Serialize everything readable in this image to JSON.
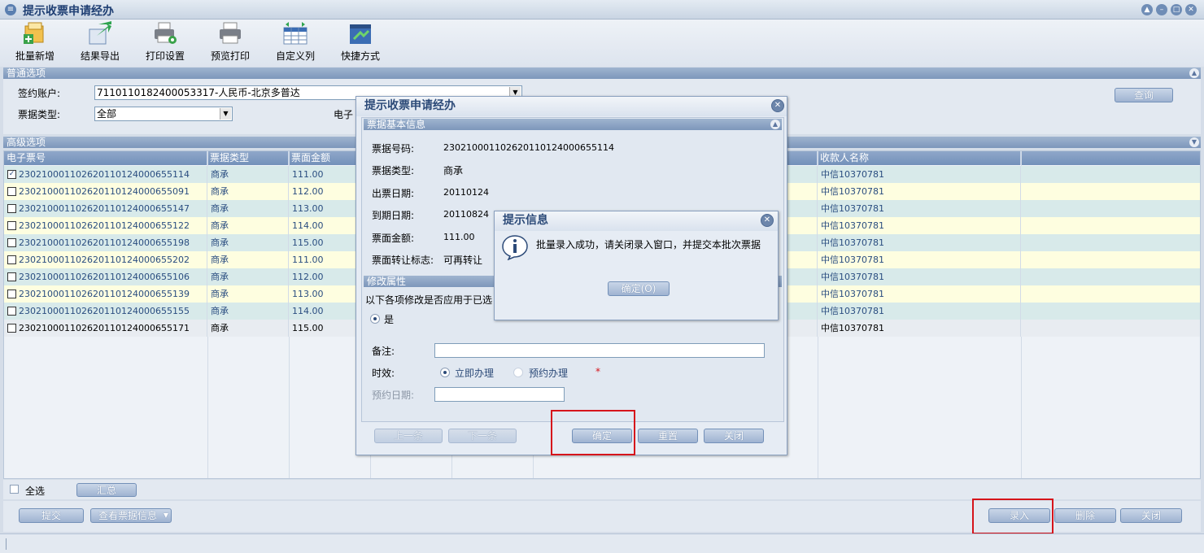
{
  "window": {
    "title": "提示收票申请经办"
  },
  "toolbar": {
    "items": [
      {
        "label": "批量新增",
        "icon": "batch-add-icon"
      },
      {
        "label": "结果导出",
        "icon": "export-icon"
      },
      {
        "label": "打印设置",
        "icon": "print-settings-icon"
      },
      {
        "label": "预览打印",
        "icon": "print-preview-icon"
      },
      {
        "label": "自定义列",
        "icon": "custom-columns-icon"
      },
      {
        "label": "快捷方式",
        "icon": "shortcut-icon"
      }
    ]
  },
  "normal_options": {
    "header": "普通选项",
    "account_label": "签约账户:",
    "account_value": "7110110182400053317-人民币-北京多普达",
    "ticket_type_label": "票据类型:",
    "ticket_type_value": "全部",
    "electronic_label_partial": "电子",
    "query_button": "查询"
  },
  "advanced_options": {
    "header": "高级选项"
  },
  "grid": {
    "columns": [
      "电子票号",
      "票据类型",
      "票面金额",
      "收款人名称"
    ],
    "rows": [
      {
        "checked": true,
        "no": "230210001102620110124000655114",
        "type": "商承",
        "amount": "111.00",
        "payee": "中信10370781"
      },
      {
        "checked": false,
        "no": "230210001102620110124000655091",
        "type": "商承",
        "amount": "112.00",
        "payee": "中信10370781"
      },
      {
        "checked": false,
        "no": "230210001102620110124000655147",
        "type": "商承",
        "amount": "113.00",
        "payee": "中信10370781"
      },
      {
        "checked": false,
        "no": "230210001102620110124000655122",
        "type": "商承",
        "amount": "114.00",
        "payee": "中信10370781"
      },
      {
        "checked": false,
        "no": "230210001102620110124000655198",
        "type": "商承",
        "amount": "115.00",
        "payee": "中信10370781"
      },
      {
        "checked": false,
        "no": "230210001102620110124000655202",
        "type": "商承",
        "amount": "111.00",
        "payee": "中信10370781"
      },
      {
        "checked": false,
        "no": "230210001102620110124000655106",
        "type": "商承",
        "amount": "112.00",
        "payee": "中信10370781"
      },
      {
        "checked": false,
        "no": "230210001102620110124000655139",
        "type": "商承",
        "amount": "113.00",
        "payee": "中信10370781"
      },
      {
        "checked": false,
        "no": "230210001102620110124000655155",
        "type": "商承",
        "amount": "114.00",
        "payee": "中信10370781"
      },
      {
        "checked": false,
        "no": "230210001102620110124000655171",
        "type": "商承",
        "amount": "115.00",
        "payee": "中信10370781"
      }
    ],
    "row_colors": [
      "#d8eaea",
      "#fefee0"
    ]
  },
  "footer": {
    "select_all": "全选",
    "summary_button": "汇总",
    "submit_button": "提交",
    "view_info_button": "查看票据信息",
    "enter_button": "录入",
    "delete_button": "删除",
    "close_button": "关闭"
  },
  "entry_dialog": {
    "title": "提示收票申请经办",
    "basic_header": "票据基本信息",
    "fields": [
      {
        "label": "票据号码:",
        "value": "230210001102620110124000655114"
      },
      {
        "label": "票据类型:",
        "value": "商承"
      },
      {
        "label": "出票日期:",
        "value": "20110124"
      },
      {
        "label": "到期日期:",
        "value": "20110824"
      },
      {
        "label": "票面金额:",
        "value": "111.00"
      },
      {
        "label": "票面转让标志:",
        "value": "可再转让"
      }
    ],
    "modify_header": "修改属性",
    "apply_question": "以下各项修改是否应用于已选",
    "yes_option": "是",
    "note_label": "备注:",
    "timing_label": "时效:",
    "immediate_option": "立即办理",
    "scheduled_option": "预约办理",
    "required_mark": "*",
    "scheduled_date_label": "预约日期:",
    "prev_button": "上一条",
    "next_button": "下一条",
    "confirm_button": "确定",
    "reset_button": "重置",
    "close_button": "关闭"
  },
  "alert_dialog": {
    "title": "提示信息",
    "message": "批量录入成功，请关闭录入窗口，并提交本批次票据",
    "ok_button": "确定(O)"
  },
  "colors": {
    "highlight": "#d6141b",
    "title_text": "#1f3f73"
  }
}
